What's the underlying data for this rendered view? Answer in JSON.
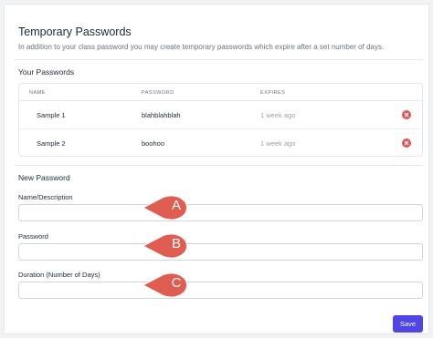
{
  "header": {
    "title": "Temporary Passwords",
    "subtitle": "In addition to your class password you may create temporary passwords which expire after a set number of days."
  },
  "passwords": {
    "section_title": "Your Passwords",
    "columns": [
      "NAME",
      "PASSWORD",
      "EXPIRES"
    ],
    "rows": [
      {
        "name": "Sample 1",
        "password": "blahblahblah",
        "expires": "1 week ago"
      },
      {
        "name": "Sample 2",
        "password": "boohoo",
        "expires": "1 week ago"
      }
    ],
    "delete_icon": "x-circle-icon",
    "delete_color": "#e55353"
  },
  "new_password": {
    "section_title": "New Password",
    "name_label": "Name/Description",
    "name_value": "",
    "password_label": "Password",
    "password_value": "",
    "duration_label": "Duration (Number of Days)",
    "duration_value": "",
    "save_label": "Save"
  },
  "annotations": {
    "markers": [
      "A",
      "B",
      "C"
    ],
    "marker_color": "#e05d52"
  },
  "colors": {
    "accent": "#4f46e5",
    "danger": "#e55353"
  }
}
